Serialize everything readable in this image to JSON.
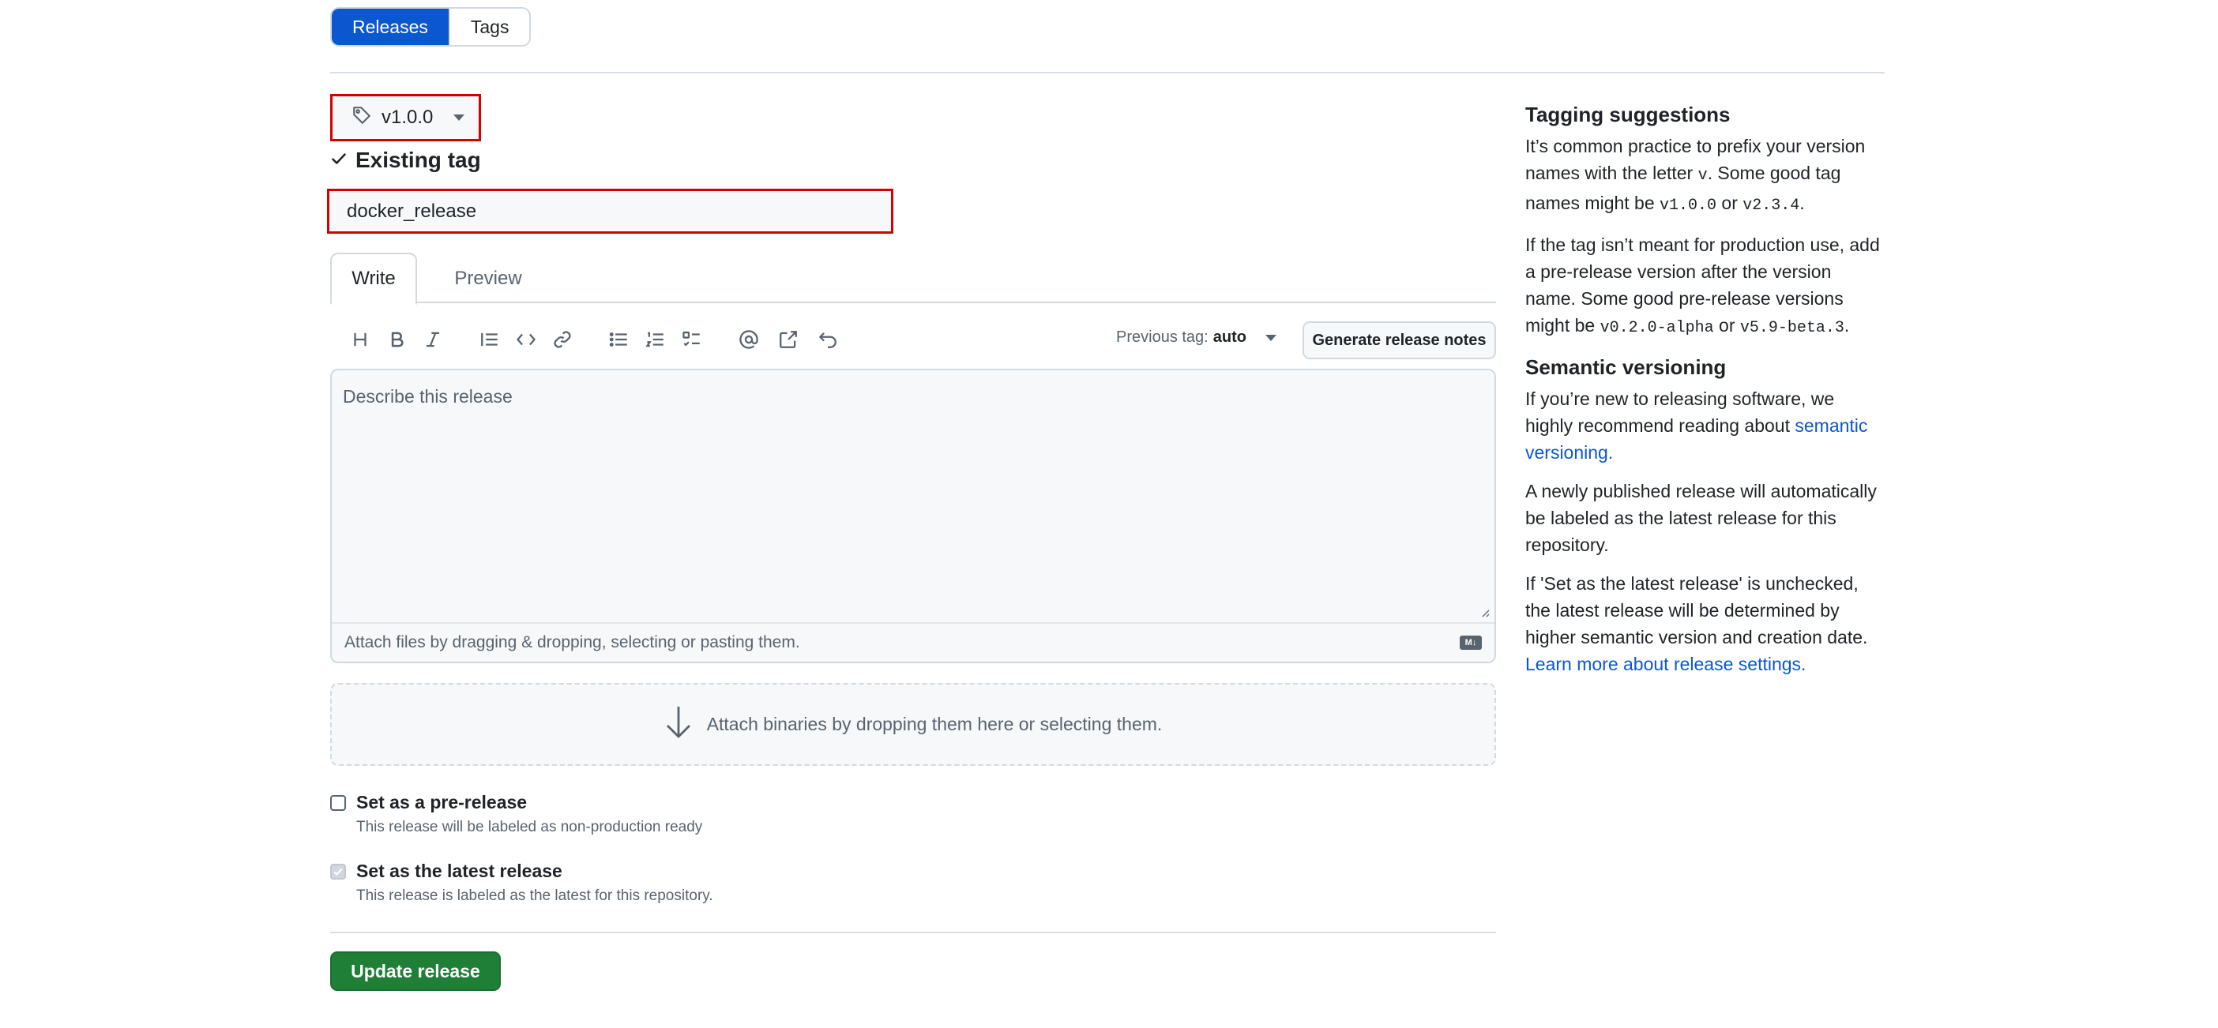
{
  "top_tabs": {
    "releases": "Releases",
    "tags": "Tags"
  },
  "tag_picker": {
    "value": "v1.0.0",
    "status": "Existing tag"
  },
  "release_title": {
    "value": "docker_release"
  },
  "editor_tabs": {
    "write": "Write",
    "preview": "Preview"
  },
  "toolbar": {
    "icons": [
      "heading-icon",
      "bold-icon",
      "italic-icon",
      "quote-icon",
      "code-icon",
      "link-icon",
      "unordered-list-icon",
      "ordered-list-icon",
      "task-list-icon",
      "mention-icon",
      "cross-reference-icon",
      "undo-icon"
    ],
    "previous_tag_label": "Previous tag:",
    "previous_tag_value": "auto",
    "generate_button": "Generate release notes"
  },
  "description": {
    "placeholder": "Describe this release",
    "attach_hint": "Attach files by dragging & dropping, selecting or pasting them.",
    "markdown_badge": "M↓"
  },
  "dropzone": {
    "text": "Attach binaries by dropping them here or selecting them."
  },
  "prerelease": {
    "label": "Set as a pre-release",
    "desc": "This release will be labeled as non-production ready",
    "checked": false
  },
  "latest": {
    "label": "Set as the latest release",
    "desc": "This release is labeled as the latest for this repository.",
    "checked": true
  },
  "submit": {
    "label": "Update release"
  },
  "sidebar": {
    "tagging_title": "Tagging suggestions",
    "p1_a": "It’s common practice to prefix your version names with the letter ",
    "p1_code1": "v",
    "p1_b": ". Some good tag names might be ",
    "p1_code2": "v1.0.0",
    "p1_c": " or ",
    "p1_code3": "v2.3.4",
    "p1_d": ".",
    "p2_a": "If the tag isn’t meant for production use, add a pre-release version after the version name. Some good pre-release versions might be ",
    "p2_code1": "v0.2.0-alpha",
    "p2_b": " or ",
    "p2_code2": "v5.9-beta.3",
    "p2_c": ".",
    "semver_title": "Semantic versioning",
    "p3_a": "If you’re new to releasing software, we highly recommend reading about ",
    "p3_link": "semantic versioning.",
    "p4": "A newly published release will automatically be labeled as the latest release for this repository.",
    "p5_a": "If 'Set as the latest release' is unchecked, the latest release will be determined by higher semantic version and creation date. ",
    "p5_link": "Learn more about release settings."
  },
  "colors": {
    "accent": "#0b57d0",
    "primary_button": "#1f7f37",
    "highlight_border": "#d40000"
  }
}
